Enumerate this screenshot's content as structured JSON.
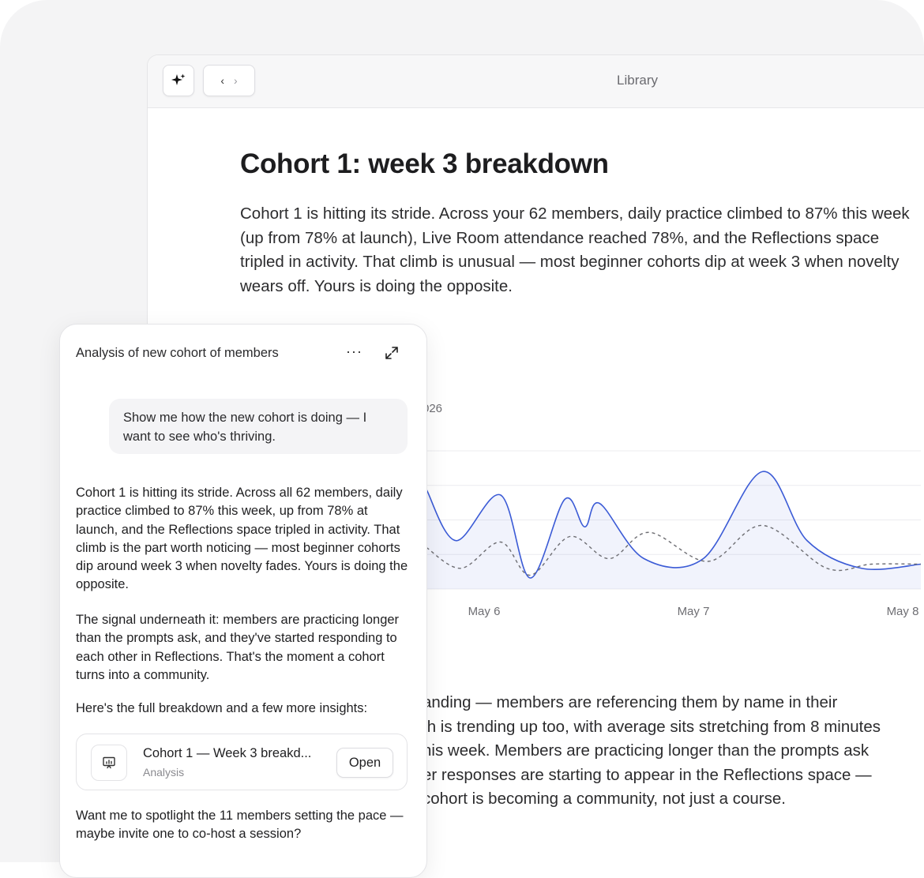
{
  "window": {
    "title": "Library"
  },
  "document": {
    "title": "Cohort 1: week 3 breakdown",
    "intro": "Cohort 1 is hitting its stride. Across your 62 members, daily practice climbed to 87% this week (up from 78% at launch), Live Room attendance reached 78%, and the Reflections space tripled in activity. That climb is unusual — most beginner cohorts dip at week 3 when novelty wears off. Yours is doing the opposite.",
    "chart_subtitle_visible": "026",
    "body_lines": [
      "anding — members are referencing them by name in their",
      "th is trending up too, with average sits stretching from 8 minutes",
      "nis week. Members are practicing longer than the prompts ask",
      "er responses are starting to appear in the Reflections space —",
      "cohort is becoming a community, not just a course."
    ]
  },
  "chart_data": {
    "type": "area",
    "title": "",
    "xlabel": "",
    "ylabel": "",
    "x_ticks": [
      "May 6",
      "May 7",
      "May 8"
    ],
    "grid": true,
    "series": [
      {
        "style": "solid-area",
        "color": "#3b5bd6",
        "points": [
          [
            0.0,
            0.72
          ],
          [
            0.06,
            0.35
          ],
          [
            0.15,
            0.68
          ],
          [
            0.21,
            0.08
          ],
          [
            0.28,
            0.65
          ],
          [
            0.32,
            0.45
          ],
          [
            0.35,
            0.62
          ],
          [
            0.44,
            0.22
          ],
          [
            0.56,
            0.22
          ],
          [
            0.68,
            0.85
          ],
          [
            0.77,
            0.35
          ],
          [
            0.88,
            0.15
          ],
          [
            1.0,
            0.18
          ]
        ]
      },
      {
        "style": "dashed",
        "color": "#6e6e73",
        "points": [
          [
            0.0,
            0.3
          ],
          [
            0.07,
            0.15
          ],
          [
            0.15,
            0.34
          ],
          [
            0.21,
            0.1
          ],
          [
            0.29,
            0.38
          ],
          [
            0.37,
            0.22
          ],
          [
            0.45,
            0.41
          ],
          [
            0.57,
            0.2
          ],
          [
            0.68,
            0.46
          ],
          [
            0.81,
            0.15
          ],
          [
            0.9,
            0.18
          ],
          [
            1.0,
            0.18
          ]
        ]
      }
    ]
  },
  "chat": {
    "title": "Analysis of new cohort of members",
    "more_label": "···",
    "user_message": "Show me how the new cohort is doing — I want to see who's thriving.",
    "reply_1": "Cohort 1 is hitting its stride. Across all 62 members, daily practice climbed to 87% this week, up from 78% at launch, and the Reflections space tripled in activity. That climb is the part worth noticing — most beginner cohorts dip around week 3 when novelty fades. Yours is doing the opposite.",
    "reply_2": "The signal underneath it: members are practicing longer than the prompts ask, and they've started responding to each other in Reflections. That's the moment a cohort turns into a community.",
    "reply_3": "Here's the full breakdown and a few more insights:",
    "card": {
      "title": "Cohort 1 — Week 3 breakd...",
      "subtitle": "Analysis",
      "open_label": "Open"
    },
    "reply_4": "Want me to spotlight the 11 members setting the pace — maybe invite one to co-host a session?"
  }
}
